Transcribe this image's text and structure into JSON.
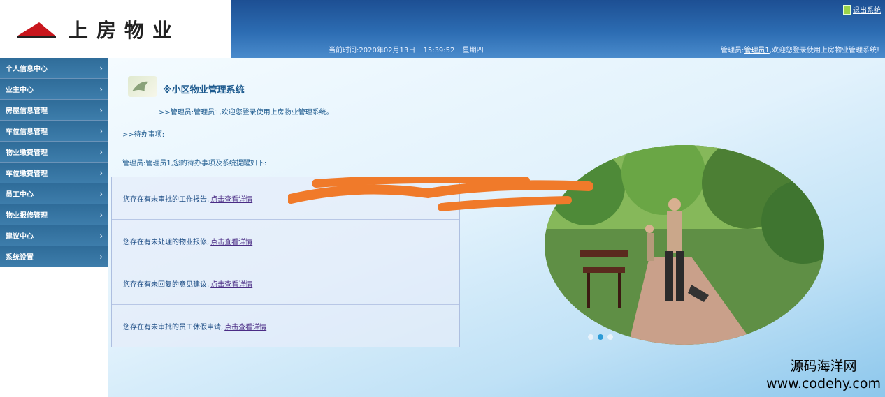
{
  "header": {
    "logo_text": "上房物业",
    "time_label": "当前时间:2020年02月13日",
    "time_clock": "15:39:52",
    "weekday": "星期四",
    "user_prefix": "管理员:",
    "user_name": "管理员1",
    "user_suffix": ",欢迎您登录使用上房物业管理系统!",
    "logout_label": "退出系统"
  },
  "sidebar": {
    "items": [
      {
        "label": "个人信息中心"
      },
      {
        "label": "业主中心"
      },
      {
        "label": "房屋信息管理"
      },
      {
        "label": "车位信息管理"
      },
      {
        "label": "物业缴费管理"
      },
      {
        "label": "车位缴费管理"
      },
      {
        "label": "员工中心"
      },
      {
        "label": "物业报修管理"
      },
      {
        "label": "建议中心"
      },
      {
        "label": "系统设置"
      }
    ],
    "chevron": "›"
  },
  "main": {
    "title": "※小区物业管理系统",
    "welcome": ">>管理员:管理员1,欢迎您登录使用上房物业管理系统。",
    "todo_label": ">>待办事项:",
    "todo_sub": "管理员:管理员1,您的待办事项及系统提醒如下:",
    "rows": [
      {
        "text": "您存在有未审批的工作报告,",
        "link": "点击查看详情"
      },
      {
        "text": "您存在有未处理的物业报修,",
        "link": "点击查看详情"
      },
      {
        "text": "您存在有未回复的意见建议,",
        "link": "点击查看详情"
      },
      {
        "text": "您存在有未审批的员工休假申请,",
        "link": "点击查看详情"
      }
    ]
  },
  "watermark": {
    "line1": "源码海洋网",
    "line2": "www.codehy.com"
  },
  "colors": {
    "header_blue": "#2c6cb2",
    "sidebar_blue": "#3d7dab",
    "link_purple": "#4a2c85",
    "annotation_orange": "#f07a2a"
  }
}
